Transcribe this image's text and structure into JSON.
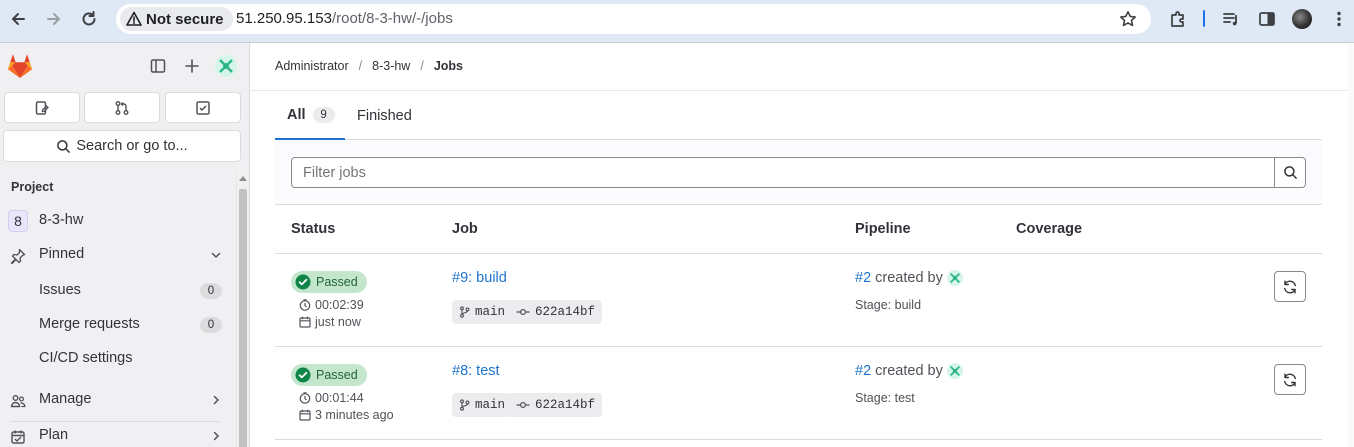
{
  "browser": {
    "security_label": "Not secure",
    "url_host": "51.250.95.153",
    "url_path": "/root/8-3-hw/-/jobs"
  },
  "sidebar": {
    "search_label": "Search or go to...",
    "section_label": "Project",
    "project": {
      "avatar_letter": "8",
      "name": "8-3-hw"
    },
    "pinned_label": "Pinned",
    "pinned_items": [
      {
        "label": "Issues",
        "count": "0"
      },
      {
        "label": "Merge requests",
        "count": "0"
      },
      {
        "label": "CI/CD settings"
      }
    ],
    "groups": [
      {
        "label": "Manage"
      },
      {
        "label": "Plan"
      }
    ]
  },
  "breadcrumb": [
    "Administrator",
    "8-3-hw",
    "Jobs"
  ],
  "tabs": [
    {
      "label": "All",
      "count": "9"
    },
    {
      "label": "Finished"
    }
  ],
  "filter": {
    "placeholder": "Filter jobs"
  },
  "table": {
    "headers": [
      "Status",
      "Job",
      "Pipeline",
      "Coverage"
    ],
    "rows": [
      {
        "status": "Passed",
        "duration": "00:02:39",
        "finished": "just now",
        "job": "#9: build",
        "ref": "main",
        "commit": "622a14bf",
        "pipeline_id": "#2",
        "created_by": "created by",
        "stage": "Stage: build"
      },
      {
        "status": "Passed",
        "duration": "00:01:44",
        "finished": "3 minutes ago",
        "job": "#8: test",
        "ref": "main",
        "commit": "622a14bf",
        "pipeline_id": "#2",
        "created_by": "created by",
        "stage": "Stage: test"
      }
    ]
  },
  "colors": {
    "brand_orange": "#e24329",
    "link_blue": "#1f75cb",
    "success_bg": "#c3e6cd",
    "success_text": "#24663b"
  }
}
